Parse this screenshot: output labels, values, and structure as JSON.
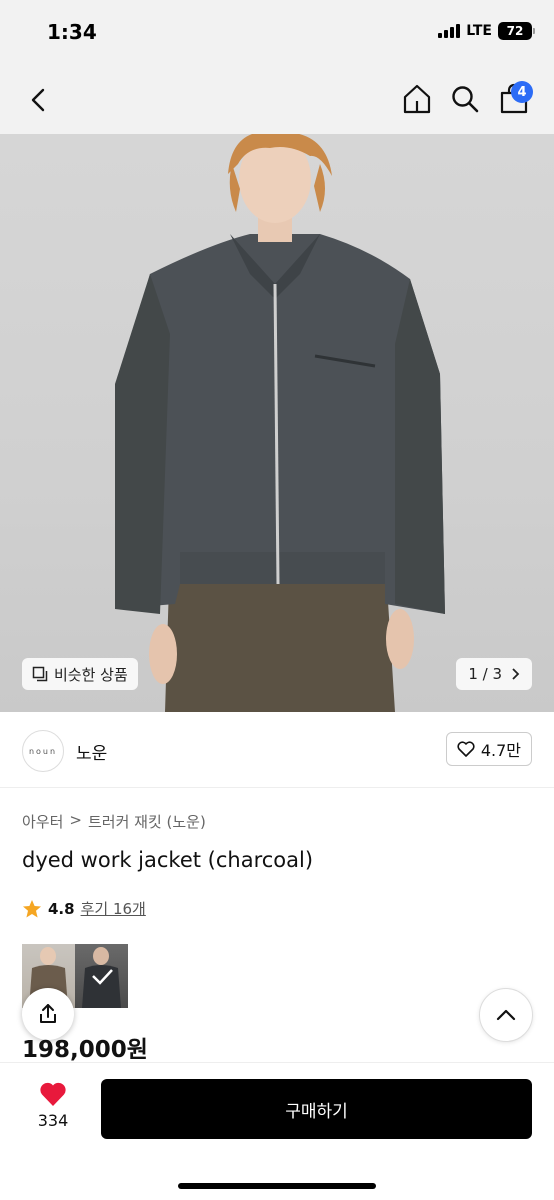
{
  "status": {
    "time": "1:34",
    "network": "LTE",
    "battery": "72"
  },
  "nav": {
    "back_icon": "chevron-left-icon",
    "home_icon": "home-icon",
    "search_icon": "search-icon",
    "cart_icon": "cart-icon",
    "cart_badge": "4"
  },
  "image": {
    "similar_label": "비슷한 상품",
    "page_indicator": "1 / 3"
  },
  "brand": {
    "logo_text": "noun",
    "name": "노운",
    "like_count": "4.7만"
  },
  "breadcrumb": {
    "category": "아우터",
    "separator": ">",
    "subcategory": "트러커 재킷 (노운)"
  },
  "product": {
    "title": "dyed work jacket (charcoal)",
    "rating": "4.8",
    "review_text": "후기 16개",
    "price": "198,000원"
  },
  "colors": {
    "accent": "#2c6cf6",
    "star": "#f5a623",
    "heart": "#e8193c",
    "buy_bg": "#000000"
  },
  "bottom": {
    "wish_count": "334",
    "buy_label": "구매하기"
  }
}
